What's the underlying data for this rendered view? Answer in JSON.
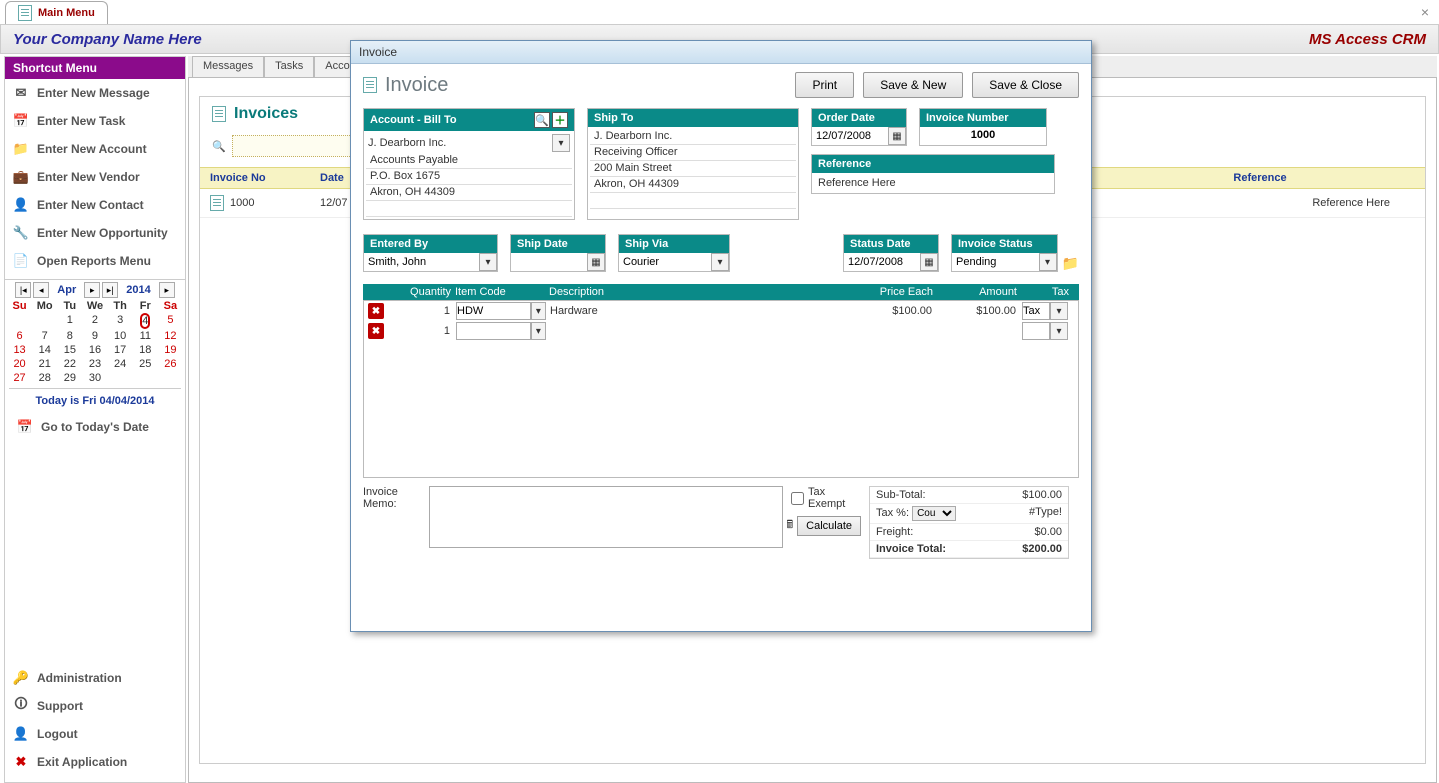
{
  "tab": {
    "label": "Main Menu"
  },
  "header": {
    "company": "Your Company Name Here",
    "right": "MS Access CRM"
  },
  "sidebar": {
    "title": "Shortcut Menu",
    "items": [
      {
        "label": "Enter New Message"
      },
      {
        "label": "Enter New Task"
      },
      {
        "label": "Enter New Account"
      },
      {
        "label": "Enter New Vendor"
      },
      {
        "label": "Enter New Contact"
      },
      {
        "label": "Enter New Opportunity"
      },
      {
        "label": "Open Reports Menu"
      }
    ],
    "calendar": {
      "month": "Apr",
      "year": "2014",
      "days": [
        "Su",
        "Mo",
        "Tu",
        "We",
        "Th",
        "Fr",
        "Sa"
      ],
      "weeks": [
        [
          "",
          "",
          "1",
          "2",
          "3",
          "4",
          "5"
        ],
        [
          "6",
          "7",
          "8",
          "9",
          "10",
          "11",
          "12"
        ],
        [
          "13",
          "14",
          "15",
          "16",
          "17",
          "18",
          "19"
        ],
        [
          "20",
          "21",
          "22",
          "23",
          "24",
          "25",
          "26"
        ],
        [
          "27",
          "28",
          "29",
          "30",
          "",
          "",
          ""
        ]
      ],
      "today_date": "4"
    },
    "today_line": "Today is Fri 04/04/2014",
    "goto": "Go to Today's Date",
    "bottom": [
      {
        "label": "Administration"
      },
      {
        "label": "Support"
      },
      {
        "label": "Logout"
      },
      {
        "label": "Exit Application"
      }
    ]
  },
  "main": {
    "tabs": [
      "Messages",
      "Tasks",
      "Accounts"
    ],
    "invoices": {
      "title": "Invoices",
      "cols": {
        "no": "Invoice No",
        "date": "Date",
        "ref": "Reference"
      },
      "rows": [
        {
          "no": "1000",
          "date": "12/07",
          "ref": "Reference Here"
        }
      ]
    }
  },
  "dialog": {
    "title": "Invoice",
    "heading": "Invoice",
    "buttons": {
      "print": "Print",
      "savenew": "Save & New",
      "saveclose": "Save & Close"
    },
    "billto": {
      "label": "Account - Bill To",
      "name": "J. Dearborn Inc.",
      "l1": "Accounts Payable",
      "l2": "P.O. Box 1675",
      "l3": "Akron, OH  44309"
    },
    "shipto": {
      "label": "Ship To",
      "name": "J. Dearborn Inc.",
      "l1": "Receiving Officer",
      "l2": "200 Main Street",
      "l3": "Akron, OH  44309"
    },
    "orderdate": {
      "label": "Order Date",
      "value": "12/07/2008"
    },
    "invno": {
      "label": "Invoice Number",
      "value": "1000"
    },
    "reference": {
      "label": "Reference",
      "value": "Reference Here"
    },
    "enteredby": {
      "label": "Entered By",
      "value": "Smith, John"
    },
    "shipdate": {
      "label": "Ship Date",
      "value": ""
    },
    "shipvia": {
      "label": "Ship Via",
      "value": "Courier"
    },
    "statusdate": {
      "label": "Status Date",
      "value": "12/07/2008"
    },
    "invstatus": {
      "label": "Invoice Status",
      "value": "Pending"
    },
    "items": {
      "cols": {
        "qty": "Quantity",
        "code": "Item Code",
        "desc": "Description",
        "price": "Price Each",
        "amount": "Amount",
        "tax": "Tax"
      },
      "rows": [
        {
          "qty": "1",
          "code": "HDW",
          "desc": "Hardware",
          "price": "$100.00",
          "amount": "$100.00",
          "tax": "Tax"
        },
        {
          "qty": "1",
          "code": "",
          "desc": "",
          "price": "",
          "amount": "",
          "tax": ""
        }
      ]
    },
    "memo": {
      "label": "Invoice Memo:",
      "value": ""
    },
    "tax_exempt": "Tax Exempt",
    "calculate": "Calculate",
    "totals": {
      "sub_lbl": "Sub-Total:",
      "sub": "$100.00",
      "tax_lbl": "Tax %:",
      "tax_sel": "Cou",
      "tax_val": "#Type!",
      "freight_lbl": "Freight:",
      "freight": "$0.00",
      "total_lbl": "Invoice Total:",
      "total": "$200.00"
    }
  }
}
